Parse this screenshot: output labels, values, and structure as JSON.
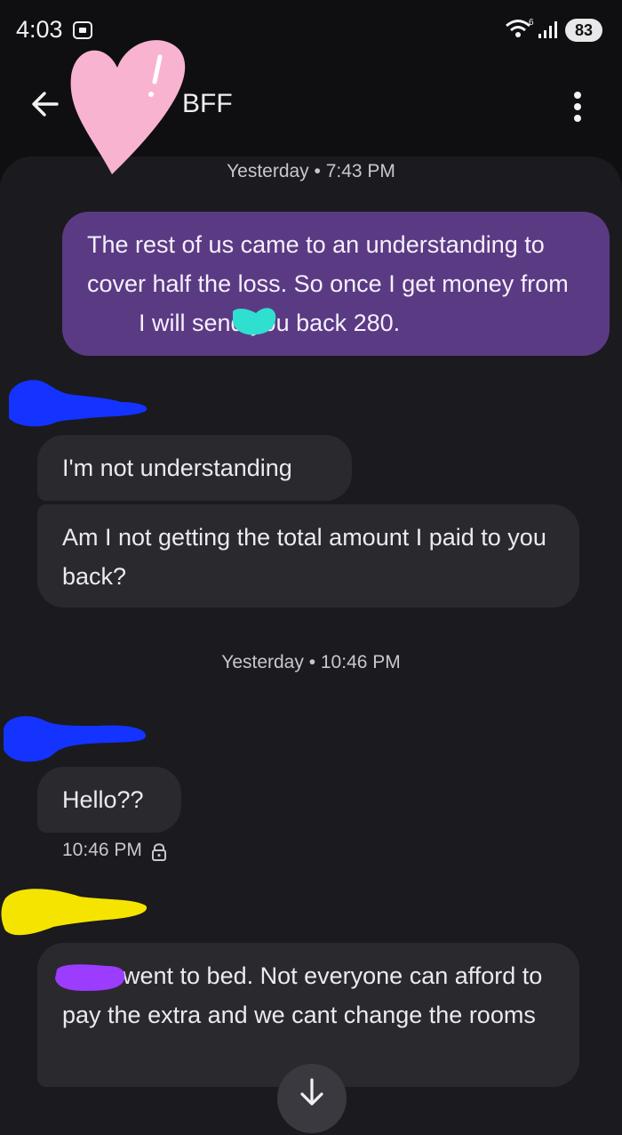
{
  "status_bar": {
    "time": "4:03",
    "battery": "83",
    "wifi_label": "6"
  },
  "header": {
    "contact_name": "BFF"
  },
  "messages": {
    "ts1": "Yesterday • 7:43 PM",
    "out1": "The rest of us came to an understanding to cover half the loss. So once I get money from",
    "out1_tail": "I will send you back 280.",
    "in1": "I'm not understanding",
    "in2": "Am I not getting the total amount I paid to you back?",
    "ts2": "Yesterday • 10:46 PM",
    "in3": "Hello??",
    "in3_time": "10:46 PM",
    "in4_tail": "went to bed. Not everyone can",
    "in4_rest": "afford to pay the extra and we cant change the rooms"
  },
  "colors": {
    "outgoing_bubble": "#5b3a84",
    "incoming_bubble": "#2a292e",
    "panel": "#1b1a1f",
    "scribble_blue": "#1433ff",
    "scribble_yellow": "#f5e400",
    "scribble_purple": "#9b3cff",
    "scribble_teal": "#2fe0d0",
    "heart_pink": "#f8b3d0"
  }
}
